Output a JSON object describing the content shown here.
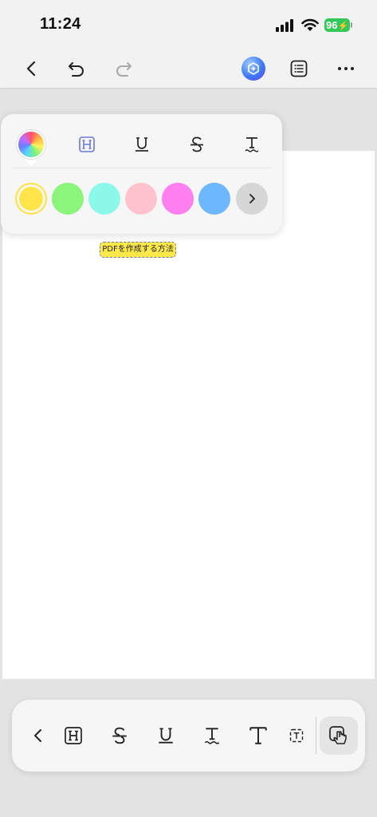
{
  "status": {
    "time": "11:24",
    "battery": "96"
  },
  "nav": {
    "back_icon": "chevron-left-icon",
    "undo_icon": "undo-icon",
    "redo_icon": "redo-icon",
    "ai_icon": "ai-assistant-icon",
    "outline_icon": "list-icon",
    "more_icon": "ellipsis-icon"
  },
  "document": {
    "highlighted_text": "PDFを作成する方法",
    "highlight_color": "#ffe94a"
  },
  "color_popup": {
    "style_options": [
      "highlight",
      "underline",
      "strikethrough",
      "squiggly",
      "text"
    ],
    "swatches": [
      {
        "name": "yellow",
        "color": "#ffe54a",
        "selected": true
      },
      {
        "name": "green",
        "color": "#8af57a",
        "selected": false
      },
      {
        "name": "cyan",
        "color": "#8cf8ea",
        "selected": false
      },
      {
        "name": "pink",
        "color": "#ffc3cf",
        "selected": false
      },
      {
        "name": "magenta",
        "color": "#ff7ef0",
        "selected": false
      },
      {
        "name": "blue",
        "color": "#6cb7ff",
        "selected": false
      }
    ]
  },
  "toolbar": {
    "items": [
      "chevron-left",
      "highlight",
      "strikethrough",
      "underline",
      "squiggly",
      "text",
      "text-box",
      "select-mode"
    ]
  }
}
